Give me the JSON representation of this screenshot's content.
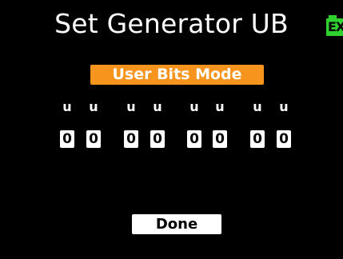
{
  "screen": {
    "title": "Set Generator UB"
  },
  "status": {
    "battery_label": "EX",
    "battery_color": "#2fd12f"
  },
  "mode_button": {
    "label": "User Bits Mode",
    "color": "#f7941d"
  },
  "user_bits": {
    "labels": [
      "u",
      "u",
      "u",
      "u",
      "u",
      "u",
      "u",
      "u"
    ],
    "digits": [
      "0",
      "0",
      "0",
      "0",
      "0",
      "0",
      "0",
      "0"
    ]
  },
  "done_button": {
    "label": "Done"
  }
}
